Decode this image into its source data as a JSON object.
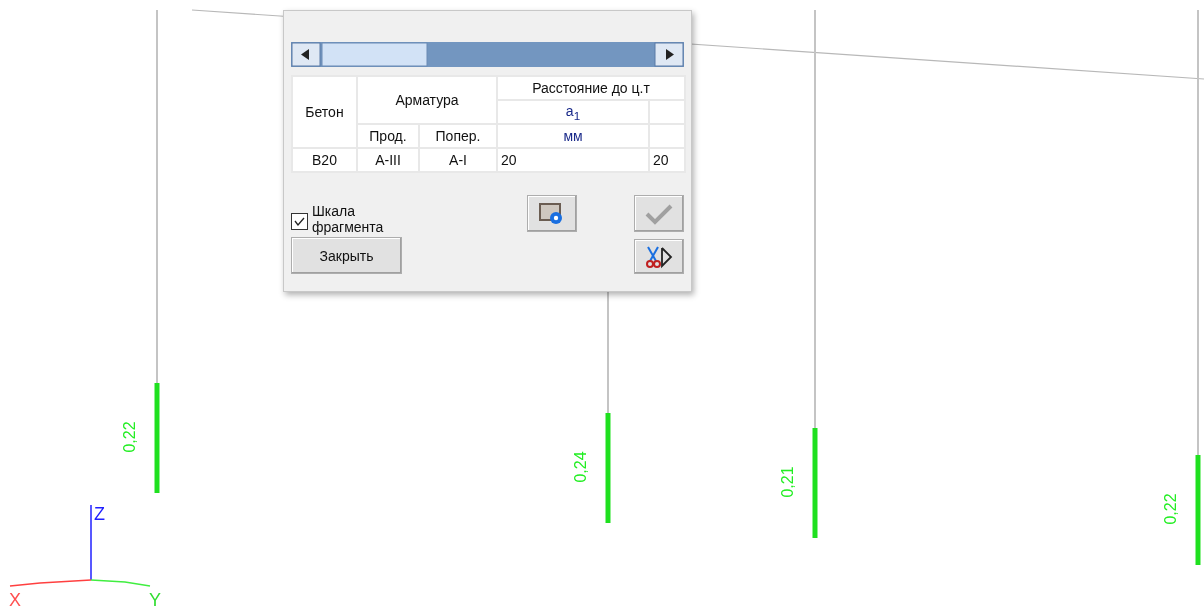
{
  "dialog": {
    "table": {
      "headers": {
        "concrete": "Бетон",
        "rebar": "Арматура",
        "distance": "Расстояние до ц.т",
        "a1": "a$_{1}$",
        "longitudinal": "Прод.",
        "transverse": "Попер.",
        "unit": "мм"
      },
      "rows": [
        {
          "cells": [
            "B20",
            "A-III",
            "A-I",
            "20",
            "20"
          ]
        }
      ]
    },
    "scale_checkbox": {
      "label": "Шкала фрагмента",
      "checked": true
    },
    "apply_button": {
      "disabled": true
    },
    "close_button": "Закрыть"
  },
  "members": [
    {
      "label": "0,22"
    },
    {
      "label": "0,24"
    },
    {
      "label": "0,21"
    },
    {
      "label": "0,22"
    }
  ],
  "axes": {
    "x": "X",
    "y": "Y",
    "z": "Z"
  }
}
